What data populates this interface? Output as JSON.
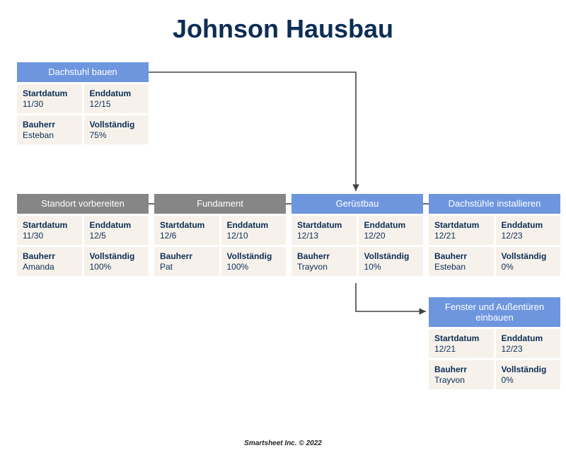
{
  "title": "Johnson Hausbau",
  "labels": {
    "start": "Startdatum",
    "end": "Enddatum",
    "owner": "Bauherr",
    "complete": "Vollständig"
  },
  "cards": {
    "dachstuhl": {
      "title": "Dachstuhl bauen",
      "start": "11/30",
      "end": "12/15",
      "owner": "Esteban",
      "complete": "75%"
    },
    "standort": {
      "title": "Standort vorbereiten",
      "start": "11/30",
      "end": "12/5",
      "owner": "Amanda",
      "complete": "100%"
    },
    "fundament": {
      "title": "Fundament",
      "start": "12/6",
      "end": "12/10",
      "owner": "Pat",
      "complete": "100%"
    },
    "geruest": {
      "title": "Gerüstbau",
      "start": "12/13",
      "end": "12/20",
      "owner": "Trayvon",
      "complete": "10%"
    },
    "install": {
      "title": "Dachstühle installieren",
      "start": "12/21",
      "end": "12/23",
      "owner": "Esteban",
      "complete": "0%"
    },
    "fenster": {
      "title": "Fenster und Außentüren einbauen",
      "start": "12/21",
      "end": "12/23",
      "owner": "Trayvon",
      "complete": "0%"
    }
  },
  "colors": {
    "blue": "#6e96df",
    "gray": "#868686",
    "navy": "#0c2d56",
    "cellbg": "#f6f2eb",
    "arrow": "#444444"
  },
  "footer": "Smartsheet Inc. © 2022"
}
